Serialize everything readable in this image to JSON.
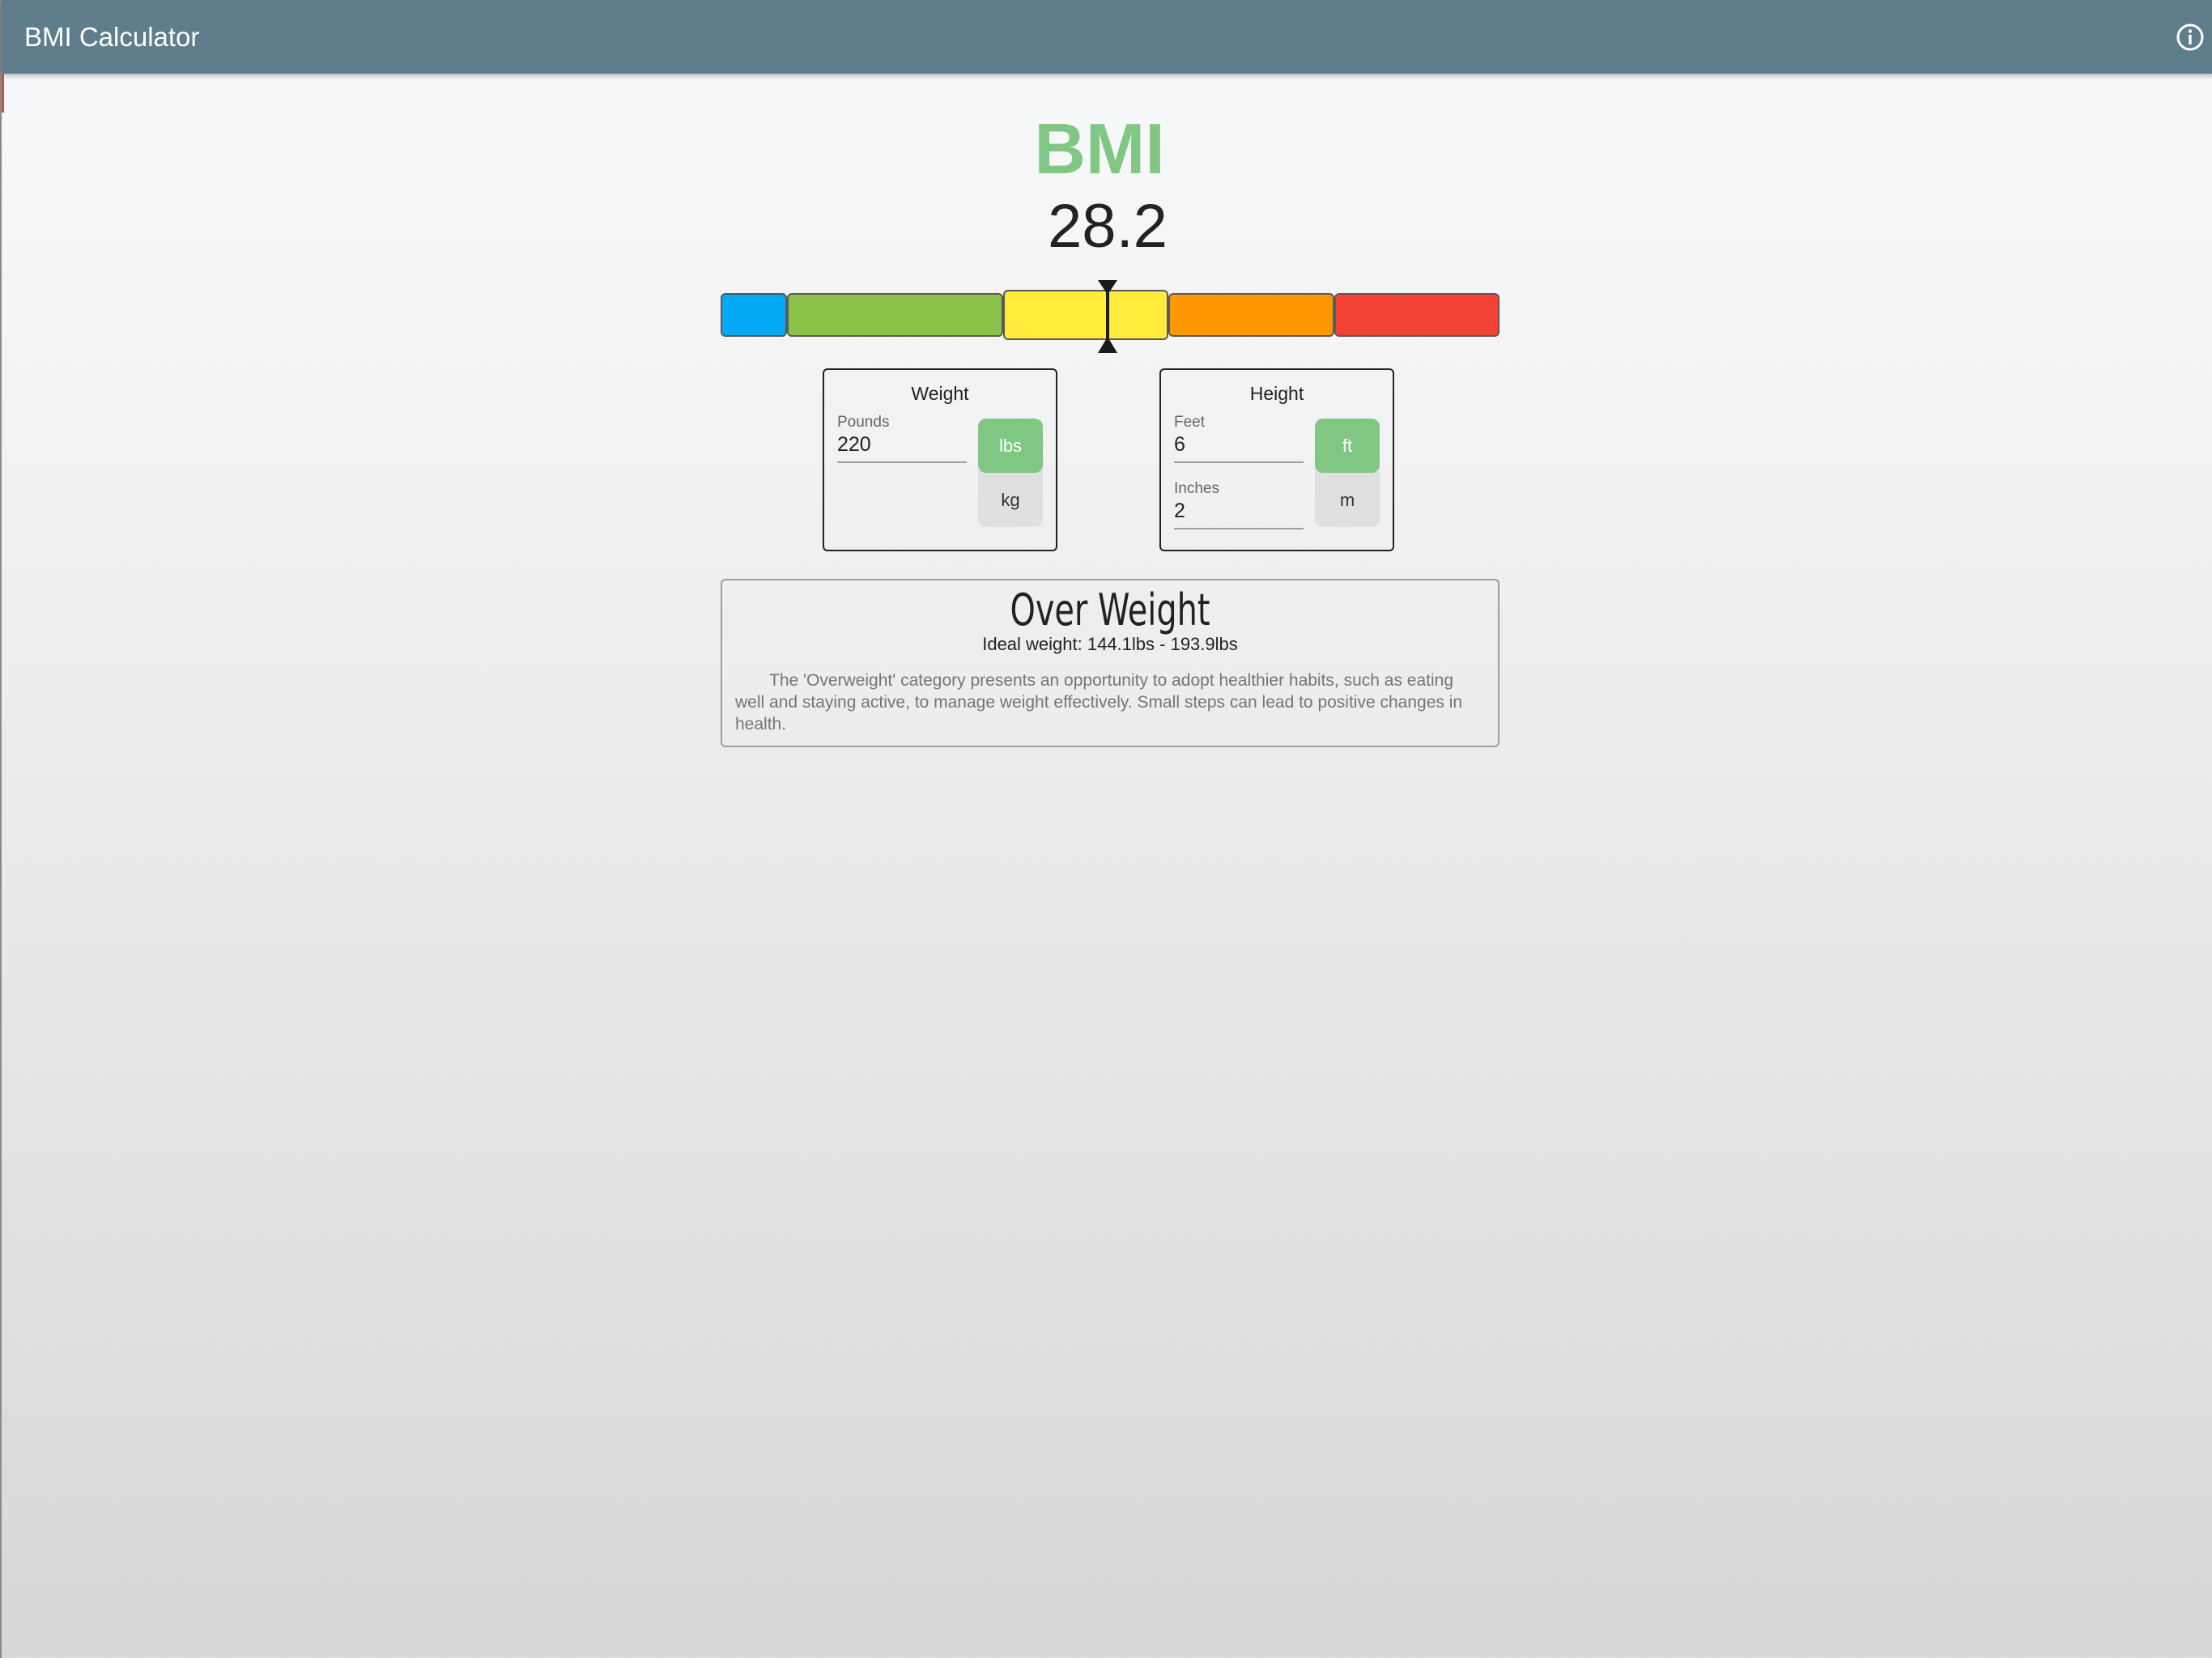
{
  "app_bar": {
    "title": "BMI Calculator",
    "info_icon": "info-circle-icon",
    "color": "#607d8b"
  },
  "bmi": {
    "heading": "BMI",
    "value": "28.2",
    "heading_color": "#81c784"
  },
  "scale": {
    "segments": [
      {
        "name": "underweight",
        "color": "#03a9f4"
      },
      {
        "name": "normal",
        "color": "#8bc34a"
      },
      {
        "name": "overweight",
        "color": "#ffeb3b",
        "active": true
      },
      {
        "name": "obese",
        "color": "#ff9800"
      },
      {
        "name": "extremely-obese",
        "color": "#f44336"
      }
    ]
  },
  "weight": {
    "title": "Weight",
    "field_label": "Pounds",
    "value": "220",
    "units": [
      "lbs",
      "kg"
    ],
    "selected_unit": "lbs"
  },
  "height": {
    "title": "Height",
    "feet_label": "Feet",
    "feet_value": "6",
    "inches_label": "Inches",
    "inches_value": "2",
    "units": [
      "ft",
      "m"
    ],
    "selected_unit": "ft"
  },
  "result": {
    "category": "Over Weight",
    "ideal_weight": "Ideal weight: 144.1lbs - 193.9lbs",
    "description": "The 'Overweight' category presents an opportunity to adopt healthier habits, such as eating well and staying active, to manage weight effectively. Small steps can lead to positive changes in health."
  },
  "accent_color": "#81c784"
}
